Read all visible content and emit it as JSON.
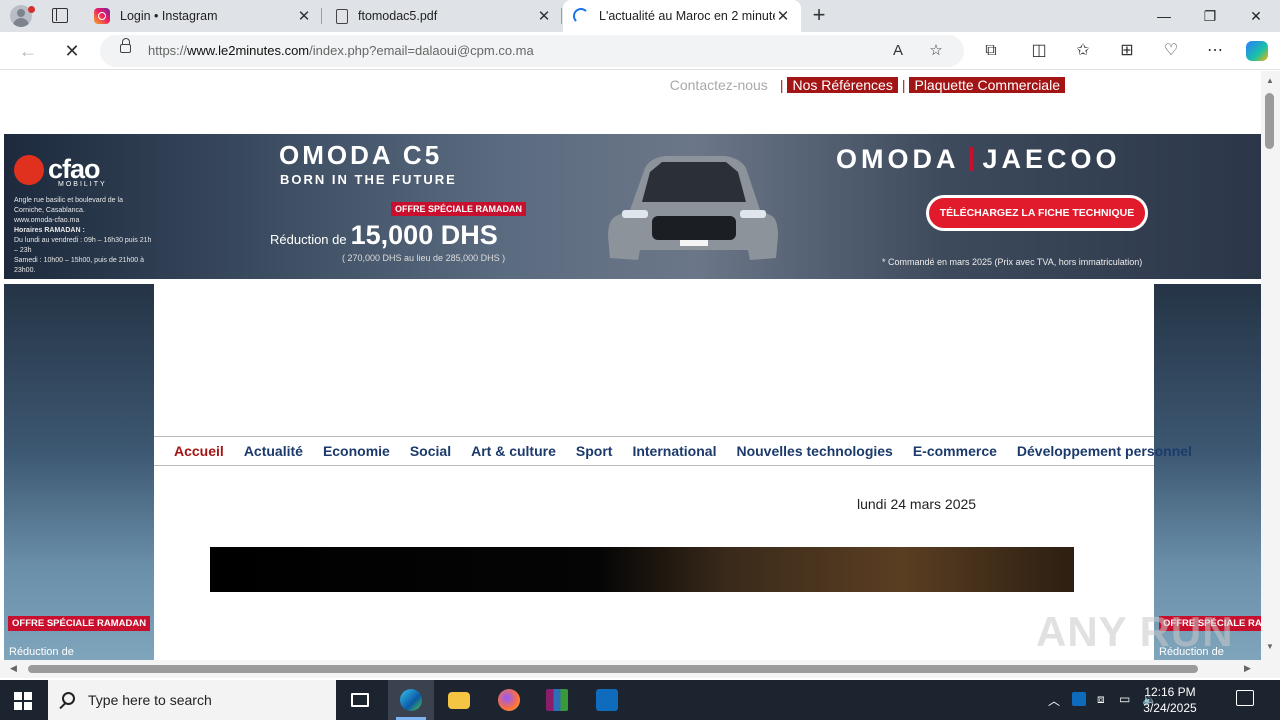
{
  "browser": {
    "tabs": [
      {
        "title": "Login • Instagram",
        "icon": "instagram-icon",
        "active": false
      },
      {
        "title": "ftomodac5.pdf",
        "icon": "pdf-document-icon",
        "active": false
      },
      {
        "title": "L'actualité au Maroc en 2 minutes",
        "icon": "loading-spinner-icon",
        "active": true
      }
    ],
    "address": {
      "prefix": "https://",
      "host": "www.le2minutes.com",
      "path": "/index.php?email=dalaoui@cpm.co.ma"
    }
  },
  "page": {
    "top_links": {
      "contact": "Contactez-nous",
      "separator": "|",
      "references": "Nos Références",
      "brochure": "Plaquette Commerciale"
    },
    "banner": {
      "brand": "cfao",
      "brand_sub": "MOBILITY",
      "address": "Angle rue basilic et boulevard de la Corniche, Casablanca.",
      "website": "www.omoda-cfao.ma",
      "hours_title": "Horaires RAMADAN :",
      "hours_week": "Du lundi au vendredi : 09h – 16h30 puis 21h – 23h",
      "hours_sat": "Samedi : 10h00 – 15h00, puis de 21h00 à 23h00.",
      "model": "OMODA C5",
      "tagline": "BORN IN THE FUTURE",
      "offer": "OFFRE SPÉCIALE RAMADAN",
      "price_prefix": "Réduction de",
      "price": "15,000 DHS",
      "price_note": "( 270,000 DHS au lieu de 285,000 DHS )",
      "brand2_left": "OMODA",
      "brand2_right": "JAECOO",
      "cta": "TÉLÉCHARGEZ LA FICHE TECHNIQUE",
      "legal": "* Commandé en mars 2025 (Prix avec TVA, hors immatriculation)"
    },
    "side_ad": {
      "offer": "OFFRE SPÉCIALE RAMADAN",
      "text": "Réduction de"
    },
    "menu": [
      {
        "label": "Accueil",
        "active": true
      },
      {
        "label": "Actualité",
        "active": false
      },
      {
        "label": "Economie",
        "active": false
      },
      {
        "label": "Social",
        "active": false
      },
      {
        "label": "Art & culture",
        "active": false
      },
      {
        "label": "Sport",
        "active": false
      },
      {
        "label": "International",
        "active": false
      },
      {
        "label": "Nouvelles technologies",
        "active": false
      },
      {
        "label": "E-commerce",
        "active": false
      },
      {
        "label": "Développement personnel",
        "active": false
      }
    ],
    "date": "lundi 24 mars 2025",
    "watermark": "ANY RUN"
  },
  "taskbar": {
    "search_placeholder": "Type here to search",
    "time": "12:16 PM",
    "date": "3/24/2025",
    "apps": [
      "task-view-icon",
      "edge-icon",
      "file-explorer-icon",
      "firefox-icon",
      "winrar-icon",
      "outlook-icon"
    ]
  },
  "colors": {
    "accent_red": "#a31515",
    "menu_blue": "#1b3a6b",
    "cta_red": "#e21b2c"
  }
}
